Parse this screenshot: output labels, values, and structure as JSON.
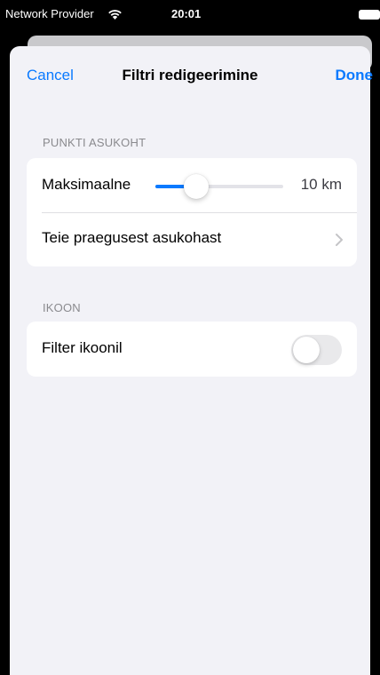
{
  "status_bar": {
    "carrier": "Network Provider",
    "time": "20:01"
  },
  "nav": {
    "cancel_label": "Cancel",
    "title": "Filtri redigeerimine",
    "done_label": "Done"
  },
  "location_section": {
    "header": "PUNKTI ASUKOHT",
    "max_label": "Maksimaalne",
    "slider_fraction": 0.32,
    "slider_value": "10 km",
    "from_location_label": "Teie praegusest asukohast"
  },
  "icon_section": {
    "header": "IKOON",
    "filter_label": "Filter ikoonil",
    "filter_enabled": false
  },
  "colors": {
    "accent": "#0a7aff",
    "background": "#f2f2f7"
  }
}
